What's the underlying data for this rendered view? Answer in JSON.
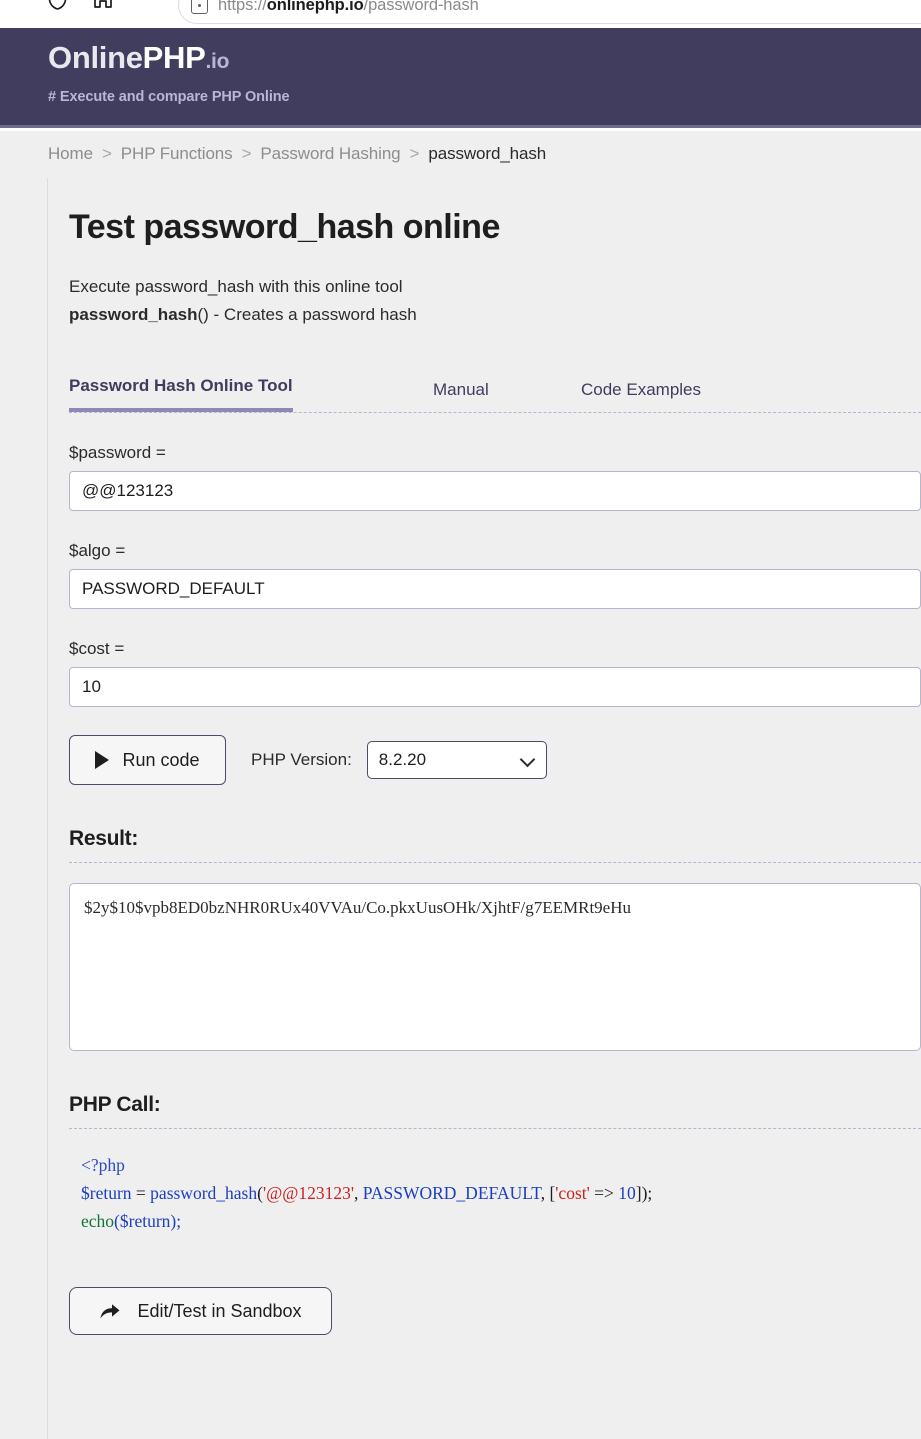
{
  "browser": {
    "url_prefix": "https://",
    "url_domain": "onlinephp.io",
    "url_path": "/password-hash",
    "shield_icon": "shield-icon",
    "home_icon": "home-icon",
    "site_info_icon": "site-info-icon"
  },
  "header": {
    "logo_part1": "Online",
    "logo_part2": "PHP",
    "logo_part3": ".io",
    "tagline": "# Execute and compare PHP Online",
    "bg_color": "#403d5e",
    "accent_color": "#b9b7d6"
  },
  "breadcrumb": {
    "separator": ">",
    "items": [
      {
        "label": "Home",
        "current": false
      },
      {
        "label": "PHP Functions",
        "current": false
      },
      {
        "label": "Password Hashing",
        "current": false
      },
      {
        "label": "password_hash",
        "current": true
      }
    ]
  },
  "main": {
    "title": "Test password_hash online",
    "lede_line1": "Execute password_hash with this online tool",
    "lede_fn": "password_hash",
    "lede_line2_rest": "() - Creates a password hash",
    "tabs": [
      {
        "label": "Password Hash Online Tool",
        "active": true
      },
      {
        "label": "Manual",
        "active": false
      },
      {
        "label": "Code Examples",
        "active": false
      }
    ]
  },
  "form": {
    "password_label": "$password =",
    "password_value": "@@123123",
    "algo_label": "$algo =",
    "algo_value": "PASSWORD_DEFAULT",
    "cost_label": "$cost =",
    "cost_value": "10",
    "run_button": "Run code",
    "run_icon": "play-icon",
    "php_version_label": "PHP Version:",
    "php_version_value": "8.2.20",
    "php_version_options": [
      "8.2.20"
    ],
    "chevron_icon": "chevron-down-icon"
  },
  "result": {
    "heading": "Result:",
    "value": "$2y$10$vpb8ED0bzNHR0RUx40VVAu/Co.pkxUusOHk/XjhtF/g7EEMRt9eHu"
  },
  "php_call": {
    "heading": "PHP Call:",
    "open_tag": "<?php",
    "var_return": "$return",
    "assign": " = ",
    "fn_name": "password_hash",
    "paren_open": "(",
    "arg_string": "'@@123123'",
    "comma1": ", ",
    "arg_const": "PASSWORD_DEFAULT",
    "comma2": ", ",
    "bracket_open": "[",
    "arg_key": "'cost'",
    "arrow": " => ",
    "arg_num": "10",
    "tail": "]);",
    "echo_fn": "echo",
    "echo_args": "($return);"
  },
  "sandbox": {
    "label": "Edit/Test in Sandbox",
    "icon": "share-arrow-icon"
  }
}
